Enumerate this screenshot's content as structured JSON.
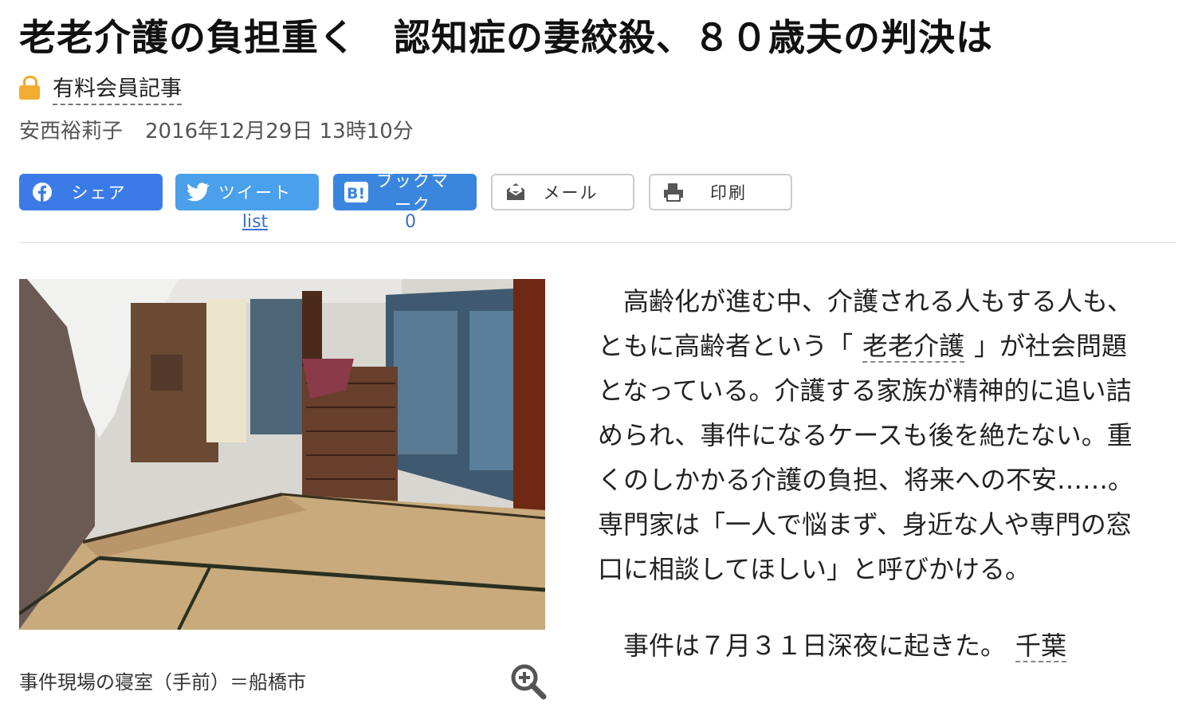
{
  "article": {
    "headline": "老老介護の負担重く　認知症の妻絞殺、８０歳夫の判決は",
    "paid_label": "有料会員記事",
    "author": "安西裕莉子",
    "date": "2016年12月29日 13時10分"
  },
  "share": {
    "facebook_label": "シェア",
    "twitter_label": "ツイート",
    "twitter_count": "list",
    "hatena_label": "ブックマーク",
    "hatena_count": "0",
    "mail_label": "メール",
    "print_label": "印刷"
  },
  "photo": {
    "caption": "事件現場の寝室（手前）＝船橋市"
  },
  "body": {
    "p1_a": "高齢化が進む中、介護される人もする人も、ともに高齢者という「",
    "p1_kw": "老老介護",
    "p1_b": "」が社会問題となっている。介護する家族が精神的に追い詰められ、事件になるケースも後を絶たない。重くのしかかる介護の負担、将来への不安……。専門家は「一人で悩まず、身近な人や専門の窓口に相談してほしい」と呼びかける。",
    "p2_a": "事件は７月３１日深夜に起きた。",
    "p2_kw": "千葉"
  },
  "colors": {
    "facebook": "#3b7be8",
    "twitter": "#4aa0eb",
    "hatena": "#3a86de",
    "lock": "#f3ad32"
  },
  "icons": [
    "lock-icon",
    "facebook-icon",
    "twitter-icon",
    "hatena-icon",
    "mail-icon",
    "printer-icon",
    "zoom-in-icon"
  ]
}
